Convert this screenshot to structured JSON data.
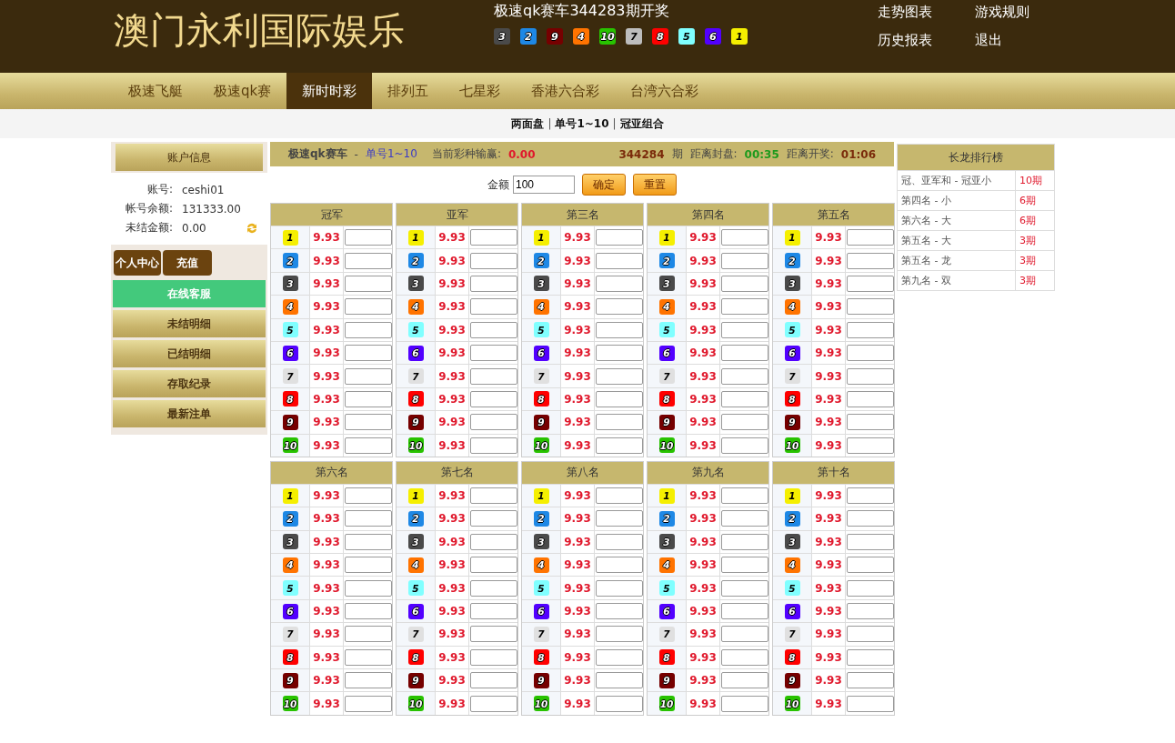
{
  "header": {
    "logo": "澳门永利国际娱乐",
    "draw_title": "极速qk赛车344283期开奖",
    "draw_results": [
      {
        "no": "3",
        "color": "#4a4a4a"
      },
      {
        "no": "2",
        "color": "#1e88e5"
      },
      {
        "no": "9",
        "color": "#760000"
      },
      {
        "no": "4",
        "color": "#ff7300"
      },
      {
        "no": "10",
        "color": "#28c200"
      },
      {
        "no": "7",
        "color": "#bdbdbd"
      },
      {
        "no": "8",
        "color": "#ff0000"
      },
      {
        "no": "5",
        "color": "#80ffff"
      },
      {
        "no": "6",
        "color": "#5200ff"
      },
      {
        "no": "1",
        "color": "#f5ef00"
      }
    ],
    "links": [
      [
        "走势图表",
        "游戏规则"
      ],
      [
        "历史报表",
        "退出"
      ]
    ]
  },
  "nav": [
    {
      "label": "极速飞艇",
      "selected": false
    },
    {
      "label": "极速qk赛",
      "selected": false
    },
    {
      "label": "新时时彩",
      "selected": true
    },
    {
      "label": "排列五",
      "selected": false
    },
    {
      "label": "七星彩",
      "selected": false
    },
    {
      "label": "香港六合彩",
      "selected": false
    },
    {
      "label": "台湾六合彩",
      "selected": false
    }
  ],
  "subnav": [
    {
      "label": "两面盘",
      "kind": "tab"
    },
    {
      "label": "|",
      "kind": "sep"
    },
    {
      "label": "单号1~10",
      "kind": "tab"
    },
    {
      "label": "|",
      "kind": "sep"
    },
    {
      "label": "冠亚组合",
      "kind": "tab"
    }
  ],
  "sidebar": {
    "title": "账户信息",
    "fields": [
      {
        "label": "账号:",
        "value": "ceshi01"
      },
      {
        "label": "帐号余额:",
        "value": "131333.00"
      },
      {
        "label": "未结金额:",
        "value": "0.00"
      }
    ],
    "buttons": [
      "个人中心",
      "充值"
    ],
    "menu": [
      {
        "label": "在线客服",
        "selected": true
      },
      {
        "label": "未结明细",
        "selected": false
      },
      {
        "label": "已结明细",
        "selected": false
      },
      {
        "label": "存取纪录",
        "selected": false
      },
      {
        "label": "最新注单",
        "selected": false
      }
    ]
  },
  "info": {
    "game": "极速qk赛车",
    "sep": "-",
    "play": "单号1~10",
    "pl_label": "当前彩种输赢:",
    "pl_value": "0.00",
    "issue": "344284",
    "issue_unit": "期",
    "close_label": "距离封盘:",
    "close_value": "00:35",
    "open_label": "距离开奖:",
    "open_value": "01:06"
  },
  "amount": {
    "label": "金额",
    "value": "100",
    "confirm": "确定",
    "reset": "重置"
  },
  "groups": [
    {
      "title": "冠军",
      "rows": [
        {
          "no": "1",
          "color": "#f5ef00",
          "odds": "9.93"
        },
        {
          "no": "2",
          "color": "#1e88e5",
          "odds": "9.93"
        },
        {
          "no": "3",
          "color": "#4a4a4a",
          "odds": "9.93"
        },
        {
          "no": "4",
          "color": "#ff7300",
          "odds": "9.93"
        },
        {
          "no": "5",
          "color": "#80ffff",
          "odds": "9.93"
        },
        {
          "no": "6",
          "color": "#5200ff",
          "odds": "9.93"
        },
        {
          "no": "7",
          "color": "#e0e0e0",
          "odds": "9.93"
        },
        {
          "no": "8",
          "color": "#ff0000",
          "odds": "9.93"
        },
        {
          "no": "9",
          "color": "#760000",
          "odds": "9.93"
        },
        {
          "no": "10",
          "color": "#28c200",
          "odds": "9.93"
        }
      ]
    },
    {
      "title": "亚军",
      "rows": [
        {
          "no": "1",
          "color": "#f5ef00",
          "odds": "9.93"
        },
        {
          "no": "2",
          "color": "#1e88e5",
          "odds": "9.93"
        },
        {
          "no": "3",
          "color": "#4a4a4a",
          "odds": "9.93"
        },
        {
          "no": "4",
          "color": "#ff7300",
          "odds": "9.93"
        },
        {
          "no": "5",
          "color": "#80ffff",
          "odds": "9.93"
        },
        {
          "no": "6",
          "color": "#5200ff",
          "odds": "9.93"
        },
        {
          "no": "7",
          "color": "#e0e0e0",
          "odds": "9.93"
        },
        {
          "no": "8",
          "color": "#ff0000",
          "odds": "9.93"
        },
        {
          "no": "9",
          "color": "#760000",
          "odds": "9.93"
        },
        {
          "no": "10",
          "color": "#28c200",
          "odds": "9.93"
        }
      ]
    },
    {
      "title": "第三名",
      "rows": [
        {
          "no": "1",
          "color": "#f5ef00",
          "odds": "9.93"
        },
        {
          "no": "2",
          "color": "#1e88e5",
          "odds": "9.93"
        },
        {
          "no": "3",
          "color": "#4a4a4a",
          "odds": "9.93"
        },
        {
          "no": "4",
          "color": "#ff7300",
          "odds": "9.93"
        },
        {
          "no": "5",
          "color": "#80ffff",
          "odds": "9.93"
        },
        {
          "no": "6",
          "color": "#5200ff",
          "odds": "9.93"
        },
        {
          "no": "7",
          "color": "#e0e0e0",
          "odds": "9.93"
        },
        {
          "no": "8",
          "color": "#ff0000",
          "odds": "9.93"
        },
        {
          "no": "9",
          "color": "#760000",
          "odds": "9.93"
        },
        {
          "no": "10",
          "color": "#28c200",
          "odds": "9.93"
        }
      ]
    },
    {
      "title": "第四名",
      "rows": [
        {
          "no": "1",
          "color": "#f5ef00",
          "odds": "9.93"
        },
        {
          "no": "2",
          "color": "#1e88e5",
          "odds": "9.93"
        },
        {
          "no": "3",
          "color": "#4a4a4a",
          "odds": "9.93"
        },
        {
          "no": "4",
          "color": "#ff7300",
          "odds": "9.93"
        },
        {
          "no": "5",
          "color": "#80ffff",
          "odds": "9.93"
        },
        {
          "no": "6",
          "color": "#5200ff",
          "odds": "9.93"
        },
        {
          "no": "7",
          "color": "#e0e0e0",
          "odds": "9.93"
        },
        {
          "no": "8",
          "color": "#ff0000",
          "odds": "9.93"
        },
        {
          "no": "9",
          "color": "#760000",
          "odds": "9.93"
        },
        {
          "no": "10",
          "color": "#28c200",
          "odds": "9.93"
        }
      ]
    },
    {
      "title": "第五名",
      "rows": [
        {
          "no": "1",
          "color": "#f5ef00",
          "odds": "9.93"
        },
        {
          "no": "2",
          "color": "#1e88e5",
          "odds": "9.93"
        },
        {
          "no": "3",
          "color": "#4a4a4a",
          "odds": "9.93"
        },
        {
          "no": "4",
          "color": "#ff7300",
          "odds": "9.93"
        },
        {
          "no": "5",
          "color": "#80ffff",
          "odds": "9.93"
        },
        {
          "no": "6",
          "color": "#5200ff",
          "odds": "9.93"
        },
        {
          "no": "7",
          "color": "#e0e0e0",
          "odds": "9.93"
        },
        {
          "no": "8",
          "color": "#ff0000",
          "odds": "9.93"
        },
        {
          "no": "9",
          "color": "#760000",
          "odds": "9.93"
        },
        {
          "no": "10",
          "color": "#28c200",
          "odds": "9.93"
        }
      ]
    },
    {
      "title": "第六名",
      "rows": [
        {
          "no": "1",
          "color": "#f5ef00",
          "odds": "9.93"
        },
        {
          "no": "2",
          "color": "#1e88e5",
          "odds": "9.93"
        },
        {
          "no": "3",
          "color": "#4a4a4a",
          "odds": "9.93"
        },
        {
          "no": "4",
          "color": "#ff7300",
          "odds": "9.93"
        },
        {
          "no": "5",
          "color": "#80ffff",
          "odds": "9.93"
        },
        {
          "no": "6",
          "color": "#5200ff",
          "odds": "9.93"
        },
        {
          "no": "7",
          "color": "#e0e0e0",
          "odds": "9.93"
        },
        {
          "no": "8",
          "color": "#ff0000",
          "odds": "9.93"
        },
        {
          "no": "9",
          "color": "#760000",
          "odds": "9.93"
        },
        {
          "no": "10",
          "color": "#28c200",
          "odds": "9.93"
        }
      ]
    },
    {
      "title": "第七名",
      "rows": [
        {
          "no": "1",
          "color": "#f5ef00",
          "odds": "9.93"
        },
        {
          "no": "2",
          "color": "#1e88e5",
          "odds": "9.93"
        },
        {
          "no": "3",
          "color": "#4a4a4a",
          "odds": "9.93"
        },
        {
          "no": "4",
          "color": "#ff7300",
          "odds": "9.93"
        },
        {
          "no": "5",
          "color": "#80ffff",
          "odds": "9.93"
        },
        {
          "no": "6",
          "color": "#5200ff",
          "odds": "9.93"
        },
        {
          "no": "7",
          "color": "#e0e0e0",
          "odds": "9.93"
        },
        {
          "no": "8",
          "color": "#ff0000",
          "odds": "9.93"
        },
        {
          "no": "9",
          "color": "#760000",
          "odds": "9.93"
        },
        {
          "no": "10",
          "color": "#28c200",
          "odds": "9.93"
        }
      ]
    },
    {
      "title": "第八名",
      "rows": [
        {
          "no": "1",
          "color": "#f5ef00",
          "odds": "9.93"
        },
        {
          "no": "2",
          "color": "#1e88e5",
          "odds": "9.93"
        },
        {
          "no": "3",
          "color": "#4a4a4a",
          "odds": "9.93"
        },
        {
          "no": "4",
          "color": "#ff7300",
          "odds": "9.93"
        },
        {
          "no": "5",
          "color": "#80ffff",
          "odds": "9.93"
        },
        {
          "no": "6",
          "color": "#5200ff",
          "odds": "9.93"
        },
        {
          "no": "7",
          "color": "#e0e0e0",
          "odds": "9.93"
        },
        {
          "no": "8",
          "color": "#ff0000",
          "odds": "9.93"
        },
        {
          "no": "9",
          "color": "#760000",
          "odds": "9.93"
        },
        {
          "no": "10",
          "color": "#28c200",
          "odds": "9.93"
        }
      ]
    },
    {
      "title": "第九名",
      "rows": [
        {
          "no": "1",
          "color": "#f5ef00",
          "odds": "9.93"
        },
        {
          "no": "2",
          "color": "#1e88e5",
          "odds": "9.93"
        },
        {
          "no": "3",
          "color": "#4a4a4a",
          "odds": "9.93"
        },
        {
          "no": "4",
          "color": "#ff7300",
          "odds": "9.93"
        },
        {
          "no": "5",
          "color": "#80ffff",
          "odds": "9.93"
        },
        {
          "no": "6",
          "color": "#5200ff",
          "odds": "9.93"
        },
        {
          "no": "7",
          "color": "#e0e0e0",
          "odds": "9.93"
        },
        {
          "no": "8",
          "color": "#ff0000",
          "odds": "9.93"
        },
        {
          "no": "9",
          "color": "#760000",
          "odds": "9.93"
        },
        {
          "no": "10",
          "color": "#28c200",
          "odds": "9.93"
        }
      ]
    },
    {
      "title": "第十名",
      "rows": [
        {
          "no": "1",
          "color": "#f5ef00",
          "odds": "9.93"
        },
        {
          "no": "2",
          "color": "#1e88e5",
          "odds": "9.93"
        },
        {
          "no": "3",
          "color": "#4a4a4a",
          "odds": "9.93"
        },
        {
          "no": "4",
          "color": "#ff7300",
          "odds": "9.93"
        },
        {
          "no": "5",
          "color": "#80ffff",
          "odds": "9.93"
        },
        {
          "no": "6",
          "color": "#5200ff",
          "odds": "9.93"
        },
        {
          "no": "7",
          "color": "#e0e0e0",
          "odds": "9.93"
        },
        {
          "no": "8",
          "color": "#ff0000",
          "odds": "9.93"
        },
        {
          "no": "9",
          "color": "#760000",
          "odds": "9.93"
        },
        {
          "no": "10",
          "color": "#28c200",
          "odds": "9.93"
        }
      ]
    }
  ],
  "ranking": {
    "title": "长龙排行榜",
    "rows": [
      {
        "name": "冠、亚军和 - 冠亚小",
        "count": "10期"
      },
      {
        "name": "第四名 - 小",
        "count": "6期"
      },
      {
        "name": "第六名 - 大",
        "count": "6期"
      },
      {
        "name": "第五名 - 大",
        "count": "3期"
      },
      {
        "name": "第五名 - 龙",
        "count": "3期"
      },
      {
        "name": "第九名 - 双",
        "count": "3期"
      }
    ]
  }
}
